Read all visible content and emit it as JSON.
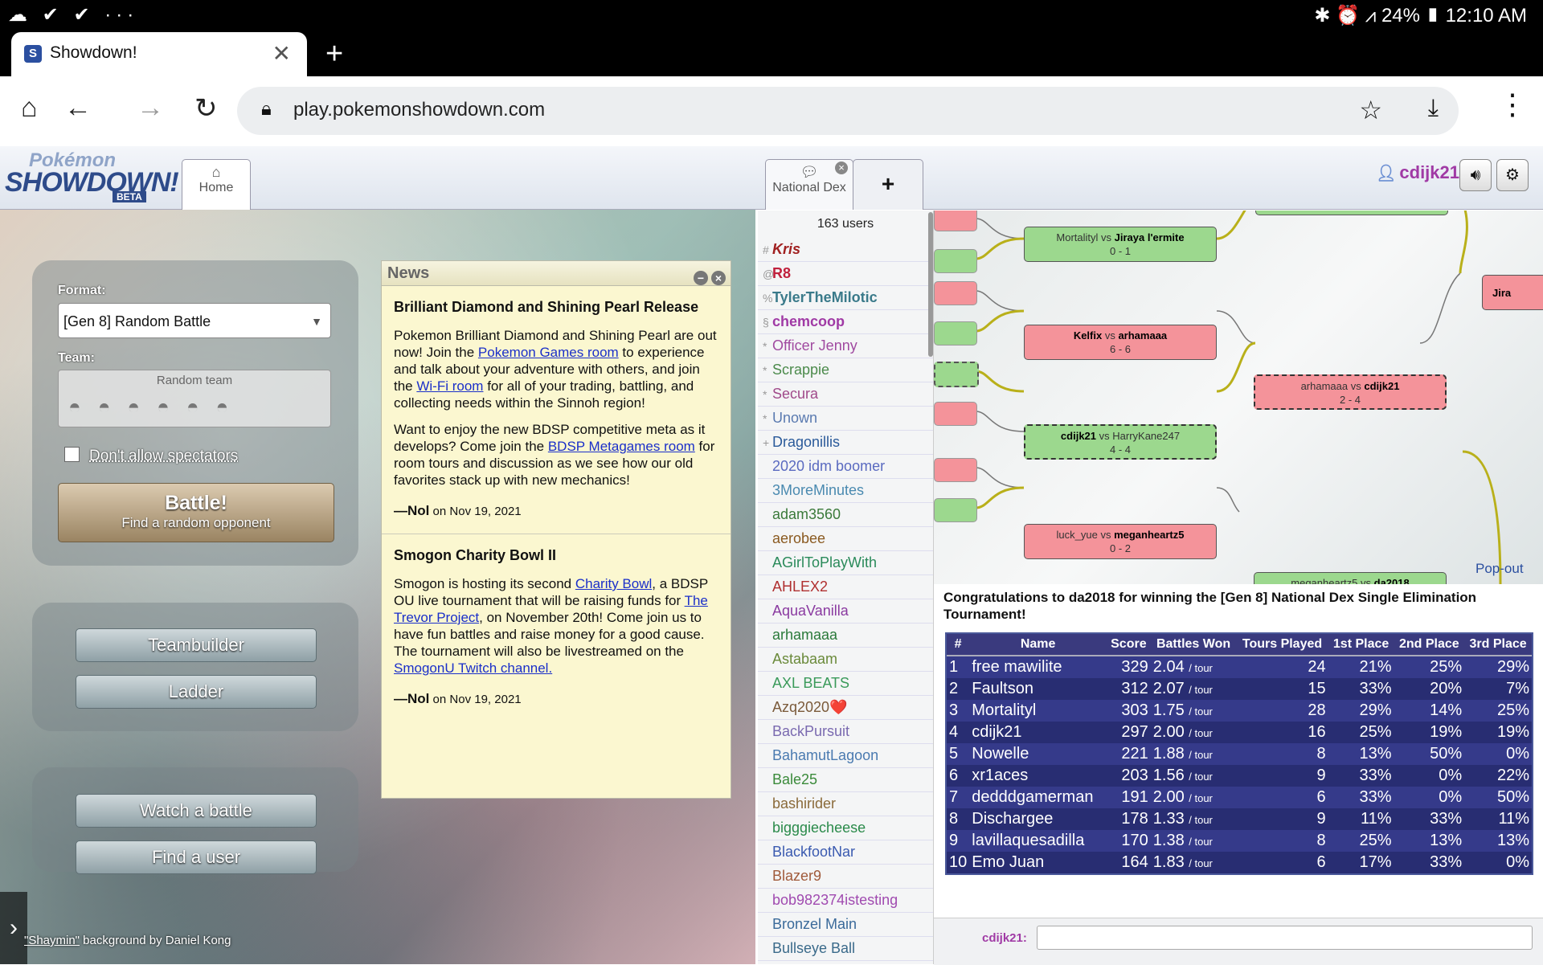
{
  "status_bar": {
    "left_icons": "☁ ✔ ✔ ···",
    "right_text": "✱ ⏰ ⩘ 24% ▮ 12:10 AM"
  },
  "browser": {
    "tab_title": "Showdown!",
    "url": "play.pokemonshowdown.com"
  },
  "ps_header": {
    "logo_top": "Pokémon",
    "logo_main": "SHOWDOWN!",
    "logo_badge": "BETA",
    "home_tab": "Home",
    "room_tab": "National Dex",
    "username": "cdijk21"
  },
  "main_menu": {
    "format_label": "Format:",
    "format_value": "[Gen 8] Random Battle",
    "team_label": "Team:",
    "team_value": "Random team",
    "spectators_label": "Don't allow spectators",
    "battle_title": "Battle!",
    "battle_subtitle": "Find a random opponent",
    "teambuilder": "Teambuilder",
    "ladder": "Ladder",
    "watch": "Watch a battle",
    "find_user": "Find a user",
    "bg_credit_name": "\"Shaymin\"",
    "bg_credit_rest": " background by Daniel Kong"
  },
  "news": {
    "title": "News",
    "item1": {
      "heading": "Brilliant Diamond and Shining Pearl Release",
      "p1a": "Pokemon Brilliant Diamond and Shining Pearl are out now! Join the ",
      "p1link1": "Pokemon Games room",
      "p1b": " to experience and talk about your adventure with others, and join the ",
      "p1link2": "Wi-Fi room",
      "p1c": " for all of your trading, battling, and collecting needs within the Sinnoh region!",
      "p2a": "Want to enjoy the new BDSP competitive meta as it develops? Come join the ",
      "p2link": "BDSP Metagames room",
      "p2b": " for room tours and discussion as we see how our old favorites stack up with new mechanics!",
      "author": "—Nol",
      "date": " on Nov 19, 2021"
    },
    "item2": {
      "heading": "Smogon Charity Bowl II",
      "p1a": "Smogon is hosting its second ",
      "link1": "Charity Bowl",
      "p1b": ", a BDSP OU live tournament that will be raising funds for ",
      "link2": "The Trevor Project",
      "p1c": ", on November 20th! Come join us to have fun battles and raise money for a good cause. The tournament will also be livestreamed on the ",
      "link3": "SmogonU Twitch channel.",
      "author": "—Nol",
      "date": " on Nov 19, 2021"
    }
  },
  "userlist": {
    "count": "163 users",
    "users": [
      {
        "g": "#",
        "n": "Kris",
        "c": "#a02020",
        "i": true
      },
      {
        "g": "@",
        "n": "R8",
        "c": "#c0203c"
      },
      {
        "g": "%",
        "n": "TylerTheMilotic",
        "c": "#3a7a8a"
      },
      {
        "g": "§",
        "n": "chemcoop",
        "c": "#a03aa5"
      },
      {
        "g": "*",
        "n": "Officer Jenny",
        "c": "#a04aa0",
        "w": "normal"
      },
      {
        "g": "*",
        "n": "Scrappie",
        "c": "#4b8a4b",
        "w": "normal"
      },
      {
        "g": "*",
        "n": "Secura",
        "c": "#a04a8a",
        "w": "normal"
      },
      {
        "g": "*",
        "n": "Unown",
        "c": "#5a7ab0",
        "w": "normal"
      },
      {
        "g": "+",
        "n": "Dragonillis",
        "c": "#2a5a9a",
        "w": "normal"
      },
      {
        "g": "",
        "n": "2020 idm boomer",
        "c": "#5a6ac0",
        "w": "normal"
      },
      {
        "g": "",
        "n": "3MoreMinutes",
        "c": "#4a8ab0",
        "w": "normal"
      },
      {
        "g": "",
        "n": "adam3560",
        "c": "#3a7a3a",
        "w": "normal"
      },
      {
        "g": "",
        "n": "aerobee",
        "c": "#8a5a20",
        "w": "normal"
      },
      {
        "g": "",
        "n": "AGirlToPlayWith",
        "c": "#2a8a5a",
        "w": "normal"
      },
      {
        "g": "",
        "n": "AHLEX2",
        "c": "#b03030",
        "w": "normal"
      },
      {
        "g": "",
        "n": "AquaVanilla",
        "c": "#8a3aa0",
        "w": "normal"
      },
      {
        "g": "",
        "n": "arhamaaa",
        "c": "#2a7a3a",
        "w": "normal"
      },
      {
        "g": "",
        "n": "Astabaam",
        "c": "#6a8a3a",
        "w": "normal"
      },
      {
        "g": "",
        "n": "AXL BEATS",
        "c": "#3a9a5a",
        "w": "normal"
      },
      {
        "g": "",
        "n": "Azq2020❤️",
        "c": "#7a5a3a",
        "w": "normal"
      },
      {
        "g": "",
        "n": "BackPursuit",
        "c": "#7a6ab0",
        "w": "normal"
      },
      {
        "g": "",
        "n": "BahamutLagoon",
        "c": "#4a7ab0",
        "w": "normal"
      },
      {
        "g": "",
        "n": "Bale25",
        "c": "#3a8a3a",
        "w": "normal"
      },
      {
        "g": "",
        "n": "bashirider",
        "c": "#8a6a3a",
        "w": "normal"
      },
      {
        "g": "",
        "n": "bigggiecheese",
        "c": "#2a8a4a",
        "w": "normal"
      },
      {
        "g": "",
        "n": "BlackfootNar",
        "c": "#3a5ab0",
        "w": "normal"
      },
      {
        "g": "",
        "n": "Blazer9",
        "c": "#a05a3a",
        "w": "normal"
      },
      {
        "g": "",
        "n": "bob982374istesting",
        "c": "#a04ab0",
        "w": "normal"
      },
      {
        "g": "",
        "n": "Bronzel Main",
        "c": "#3a6a9a",
        "w": "normal"
      },
      {
        "g": "",
        "n": "Bullseye Ball",
        "c": "#3a6a8a",
        "w": "normal"
      }
    ]
  },
  "bracket": {
    "m1": {
      "a": "Mortalityl",
      "vs": " vs ",
      "b": "Jiraya l'ermite",
      "score": "0 - 1"
    },
    "m2": {
      "a": "Kelfix",
      "vs": " vs ",
      "b": "arhamaaa",
      "score": "6 - 6"
    },
    "m3": {
      "a": "cdijk21",
      "vs": " vs ",
      "b": "HarryKane247",
      "score": "4 - 4"
    },
    "m4": {
      "a": "luck_yue",
      "vs": " vs ",
      "b": "meganheartz5",
      "score": "0 - 2"
    },
    "m5": {
      "a": "arhamaaa",
      "vs": " vs ",
      "b": "cdijk21",
      "score": "2 - 4"
    },
    "m6": {
      "a": "meganheartz5",
      "vs": " vs ",
      "b": "da2018",
      "score": ""
    },
    "m7": {
      "a": "Jira",
      "vs": "",
      "b": "",
      "score": ""
    },
    "popout": "Pop-out"
  },
  "congrats": "Congratulations to da2018 for winning the [Gen 8] National Dex Single Elimination Tournament!",
  "leaderboard": {
    "headers": [
      "#",
      "Name",
      "Score",
      "Battles Won",
      "Tours Played",
      "1st Place",
      "2nd Place",
      "3rd Place"
    ],
    "per_tour": "/ tour",
    "rows": [
      [
        "1",
        "free mawilite",
        "329",
        "2.04",
        "24",
        "21%",
        "25%",
        "29%"
      ],
      [
        "2",
        "Faultson",
        "312",
        "2.07",
        "15",
        "33%",
        "20%",
        "7%"
      ],
      [
        "3",
        "Mortalityl",
        "303",
        "1.75",
        "28",
        "29%",
        "14%",
        "25%"
      ],
      [
        "4",
        "cdijk21",
        "297",
        "2.00",
        "16",
        "25%",
        "19%",
        "19%"
      ],
      [
        "5",
        "Nowelle",
        "221",
        "1.88",
        "8",
        "13%",
        "50%",
        "0%"
      ],
      [
        "6",
        "xr1aces",
        "203",
        "1.56",
        "9",
        "33%",
        "0%",
        "22%"
      ],
      [
        "7",
        "dedddgamerman",
        "191",
        "2.00",
        "6",
        "33%",
        "0%",
        "50%"
      ],
      [
        "8",
        "Dischargee",
        "178",
        "1.33",
        "9",
        "11%",
        "33%",
        "11%"
      ],
      [
        "9",
        "lavillaquesadilla",
        "170",
        "1.38",
        "8",
        "25%",
        "13%",
        "13%"
      ],
      [
        "10",
        "Emo Juan",
        "164",
        "1.83",
        "6",
        "17%",
        "33%",
        "0%"
      ]
    ]
  },
  "chat": {
    "username": "cdijk21:"
  }
}
